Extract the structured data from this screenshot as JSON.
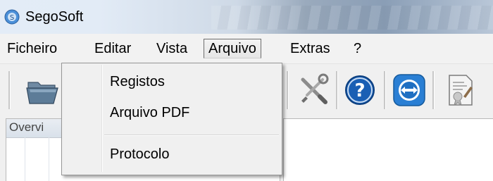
{
  "window": {
    "title": "SegoSoft",
    "icon": "segosoft-app-icon"
  },
  "menubar": {
    "items": [
      {
        "label": "Ficheiro"
      },
      {
        "label": "Editar"
      },
      {
        "label": "Vista"
      },
      {
        "label": "Arquivo",
        "open": true
      },
      {
        "label": "Extras"
      },
      {
        "label": "?"
      }
    ]
  },
  "dropdown": {
    "items": [
      {
        "label": "Registos"
      },
      {
        "label": "Arquivo PDF"
      },
      {
        "label": "Protocolo"
      }
    ]
  },
  "toolbar": {
    "icons": [
      "folder-open-icon",
      "tools-icon",
      "help-icon",
      "teamviewer-icon",
      "certificate-document-icon"
    ]
  },
  "overview": {
    "label": "Overvi"
  },
  "colors": {
    "help_blue": "#1a5fb4",
    "teamviewer_blue": "#2a7fd4",
    "menu_open_border": "#6d6d6d"
  }
}
